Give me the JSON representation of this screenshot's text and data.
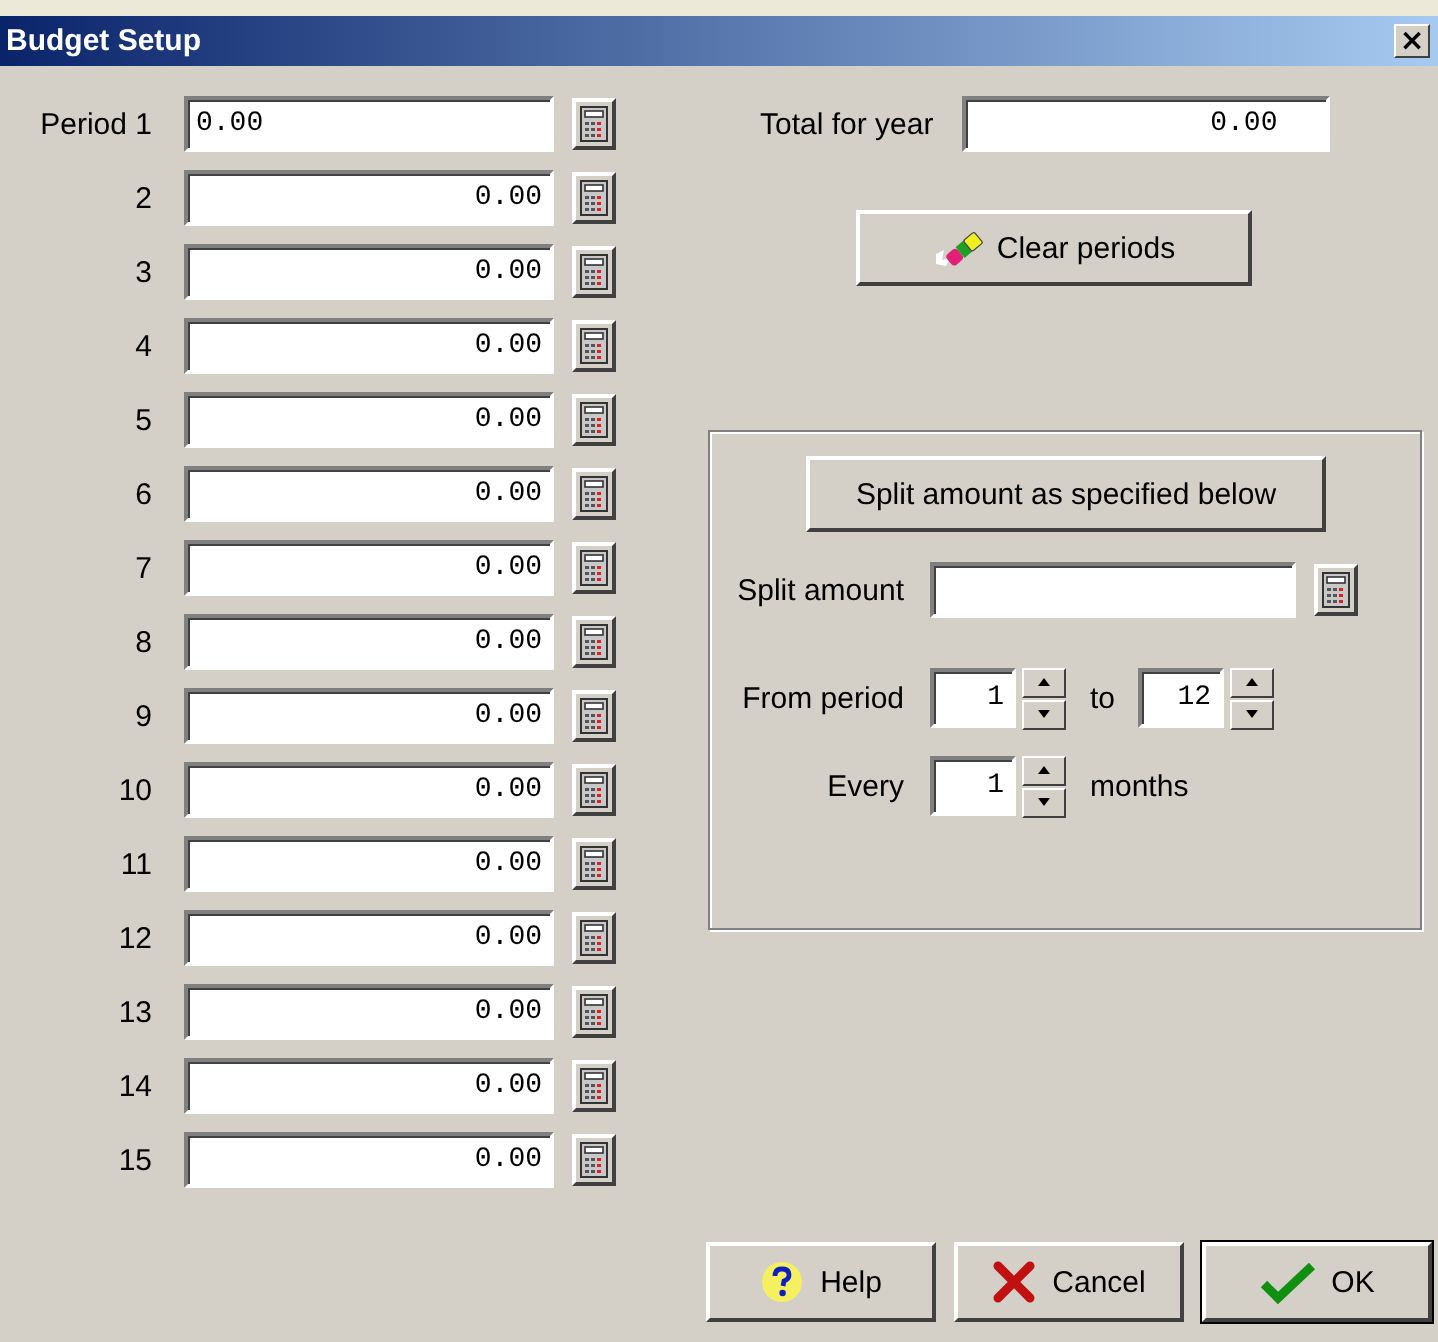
{
  "window": {
    "title": "Budget Setup",
    "close_glyph": "×"
  },
  "periods": [
    {
      "label": "Period 1",
      "value": "0.00",
      "left_aligned": true
    },
    {
      "label": "2",
      "value": "0.00",
      "left_aligned": false
    },
    {
      "label": "3",
      "value": "0.00",
      "left_aligned": false
    },
    {
      "label": "4",
      "value": "0.00",
      "left_aligned": false
    },
    {
      "label": "5",
      "value": "0.00",
      "left_aligned": false
    },
    {
      "label": "6",
      "value": "0.00",
      "left_aligned": false
    },
    {
      "label": "7",
      "value": "0.00",
      "left_aligned": false
    },
    {
      "label": "8",
      "value": "0.00",
      "left_aligned": false
    },
    {
      "label": "9",
      "value": "0.00",
      "left_aligned": false
    },
    {
      "label": "10",
      "value": "0.00",
      "left_aligned": false
    },
    {
      "label": "11",
      "value": "0.00",
      "left_aligned": false
    },
    {
      "label": "12",
      "value": "0.00",
      "left_aligned": false
    },
    {
      "label": "13",
      "value": "0.00",
      "left_aligned": false
    },
    {
      "label": "14",
      "value": "0.00",
      "left_aligned": false
    },
    {
      "label": "15",
      "value": "0.00",
      "left_aligned": false
    }
  ],
  "total": {
    "label": "Total for year",
    "value": "0.00"
  },
  "clear_button": "Clear periods",
  "split": {
    "button": "Split amount as specified below",
    "amount_label": "Split amount",
    "from_label": "From period",
    "from_value": "1",
    "to_label": "to",
    "to_value": "12",
    "every_label": "Every",
    "every_value": "1",
    "months_label": "months"
  },
  "buttons": [
    {
      "kind": "help",
      "label": "Help",
      "default": false
    },
    {
      "kind": "cancel",
      "label": "Cancel",
      "default": false
    },
    {
      "kind": "ok",
      "label": "OK",
      "default": true
    }
  ]
}
